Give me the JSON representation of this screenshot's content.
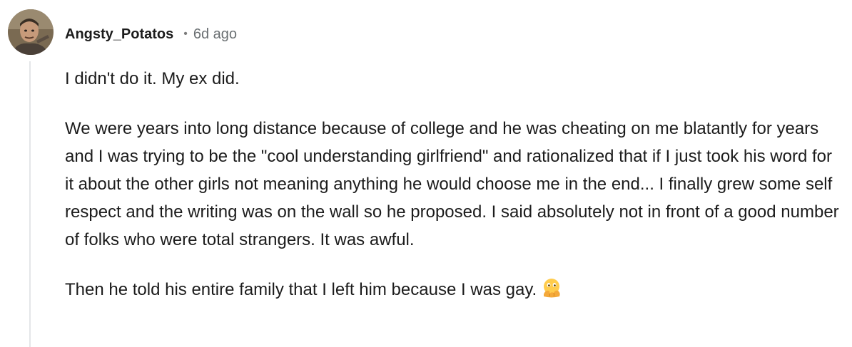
{
  "comment": {
    "author": "Angsty_Potatos",
    "separator": "•",
    "timestamp": "6d ago",
    "avatar_icon": "user-avatar-icon",
    "paragraphs": [
      "I didn't do it. My ex did.",
      "We were years into long distance because of college and he was cheating on me blatantly for years and I was trying to be the \"cool understanding girlfriend\" and rationalized that if I just took his word for it about the other girls not meaning anything he would choose me in the end... I finally grew some self respect and the writing was on the wall so he proposed. I said absolutely not in front of a good number of folks who were total strangers. It was awful.",
      "Then he told his entire family that I left him because I was gay."
    ],
    "emoji_icon": "hand-over-mouth-emoji-icon"
  },
  "colors": {
    "text": "#1c1c1c",
    "meta": "#6a6f72",
    "thread_line": "#e4e6e8",
    "emoji": "#ffcc4d"
  }
}
